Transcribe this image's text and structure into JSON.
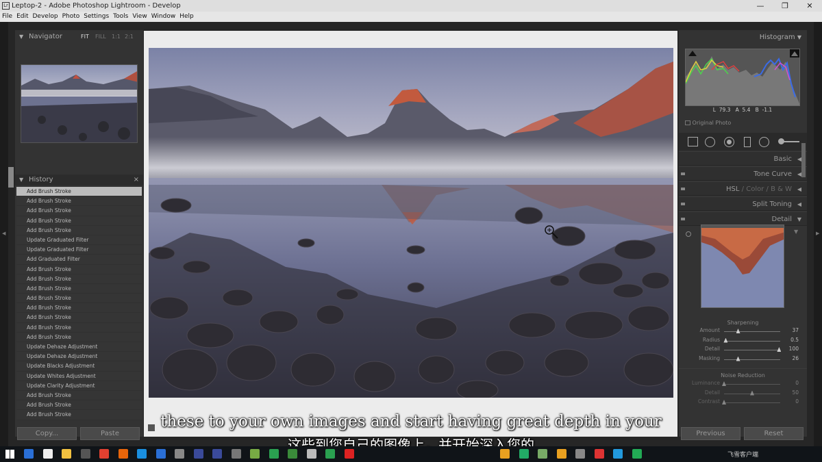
{
  "window": {
    "title": "Leptop-2 - Adobe Photoshop Lightroom - Develop",
    "app_icon": "Lr",
    "min": "—",
    "max": "❐",
    "close": "✕"
  },
  "menu": [
    "File",
    "Edit",
    "Develop",
    "Photo",
    "Settings",
    "Tools",
    "View",
    "Window",
    "Help"
  ],
  "navigator": {
    "title": "Navigator",
    "zoom": [
      "FIT",
      "FILL",
      "1:1",
      "2:1"
    ]
  },
  "history": {
    "title": "History",
    "close": "×",
    "items": [
      "Add Brush Stroke",
      "Add Brush Stroke",
      "Add Brush Stroke",
      "Add Brush Stroke",
      "Add Brush Stroke",
      "Update Graduated Filter",
      "Update Graduated Filter",
      "Add Graduated Filter",
      "Add Brush Stroke",
      "Add Brush Stroke",
      "Add Brush Stroke",
      "Add Brush Stroke",
      "Add Brush Stroke",
      "Add Brush Stroke",
      "Add Brush Stroke",
      "Add Brush Stroke",
      "Update Dehaze Adjustment",
      "Update Dehaze Adjustment",
      "Update Blacks Adjustment",
      "Update Whites Adjustment",
      "Update Clarity Adjustment",
      "Add Brush Stroke",
      "Add Brush Stroke",
      "Add Brush Stroke"
    ]
  },
  "left_buttons": {
    "copy": "Copy...",
    "paste": "Paste"
  },
  "histogram": {
    "title": "Histogram",
    "L": "L",
    "L_val": "79.3",
    "A": "A",
    "A_val": "5.4",
    "B": "B",
    "B_val": "-1.1",
    "original_photo": "Original Photo"
  },
  "sections": {
    "basic": "Basic",
    "tone_curve": "Tone Curve",
    "hsl": "HSL",
    "color": "Color",
    "bw": "B & W",
    "split_toning": "Split Toning",
    "detail": "Detail"
  },
  "sharpening": {
    "title": "Sharpening",
    "rows": [
      {
        "label": "Amount",
        "value": "37",
        "pos": 0.25
      },
      {
        "label": "Radius",
        "value": "0.5",
        "pos": 0.03
      },
      {
        "label": "Detail",
        "value": "100",
        "pos": 0.98
      },
      {
        "label": "Masking",
        "value": "26",
        "pos": 0.25
      }
    ]
  },
  "noise_reduction": {
    "title": "Noise Reduction",
    "rows": [
      {
        "label": "Luminance",
        "value": "0",
        "pos": 0.0
      },
      {
        "label": "Detail",
        "value": "50",
        "pos": 0.5
      },
      {
        "label": "Contrast",
        "value": "0",
        "pos": 0.0
      }
    ]
  },
  "right_buttons": {
    "previous": "Previous",
    "reset": "Reset"
  },
  "subtitles": {
    "english": "these to your own images and start having great depth in your",
    "chinese": "这些到您自己的图像上，并开始深入您的"
  },
  "taskbar": {
    "watermark": "飞雪客户端",
    "colors": [
      "#2a6fd6",
      "#eee",
      "#f0c040",
      "#555",
      "#e04030",
      "#e8650a",
      "#1a8fe0",
      "#2a6fd6",
      "#888",
      "#3a4a9a",
      "#3a4a9a",
      "#777",
      "#7a4",
      "#2aa050",
      "#3a8a3a",
      "#bbb",
      "#2aa050",
      "#d22",
      "#e8a020",
      "#2a6",
      "#7a6",
      "#e8a020",
      "#888",
      "#d33",
      "#29d",
      "#2a5"
    ]
  }
}
